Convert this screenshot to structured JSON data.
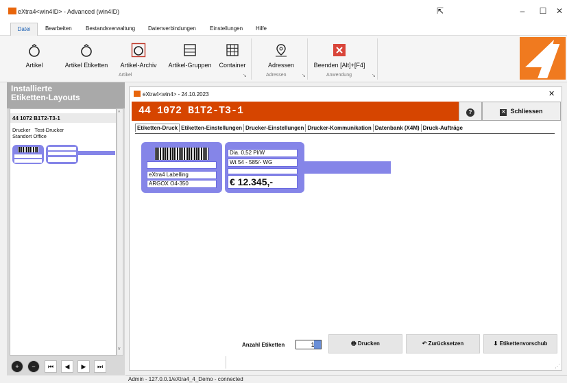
{
  "window": {
    "title": "eXtra4<win4ID>  -  Advanced (win4ID)",
    "min": "–",
    "max": "☐",
    "close": "✕"
  },
  "menu": {
    "file": "Datei",
    "edit": "Bearbeiten",
    "stock": "Bestandsverwaltung",
    "data": "Datenverbindungen",
    "settings": "Einstellungen",
    "help": "Hilfe"
  },
  "ribbon": {
    "artikel": "Artikel",
    "artikel_etiketten": "Artikel Etiketten",
    "artikel_archiv": "Artikel-Archiv",
    "artikel_gruppen": "Artikel-Gruppen",
    "container": "Container",
    "adressen": "Adressen",
    "beenden": "Beenden [Alt]+[F4]",
    "grp_artikel": "Artikel",
    "grp_adressen": "Adressen",
    "grp_anwendung": "Anwendung"
  },
  "left_panel": {
    "title_line1": "Installierte",
    "title_line2": "Etiketten-Layouts",
    "item_title": "44 1072 B1T2-T3-1",
    "label_printer": "Drucker",
    "value_printer": "Test-Drucker",
    "label_location": "Standort",
    "value_location": "Office",
    "nav": [
      "+",
      "−",
      "⏮",
      "◀",
      "▶",
      "⏭"
    ]
  },
  "dialog": {
    "title": "eXtra4<win4> - 24.10.2023",
    "close": "✕",
    "heading": "44 1072 B1T2-T3-1",
    "help": "?",
    "close_btn": "Schliessen",
    "tabs": [
      "Etiketten-Druck",
      "Etiketten-Einstellungen",
      "Drucker-Einstellungen",
      "Drucker-Kommunikation",
      "Datenbank (X4M)",
      "Druck-Aufträge"
    ],
    "label_left": {
      "line1": "eXtra4 Labelling",
      "line2": "ARGOX O4-350"
    },
    "label_right": {
      "line1": "Dia. 0,52 Pl/W",
      "line2": "Wt 54 - 585/- WG",
      "price": "€ 12.345,-"
    },
    "count_label": "Anzahl Etiketten",
    "count_value": "1",
    "print_btn": "Drucken",
    "reset_btn": "Zurücksetzen",
    "feed_btn": "Etikettenvorschub"
  },
  "status": {
    "text": "Admin - 127.0.0.1/eXtra4_4_Demo - connected"
  },
  "colors": {
    "accent": "#d64500",
    "label": "#8585e8",
    "brand": "#f07a1f"
  }
}
